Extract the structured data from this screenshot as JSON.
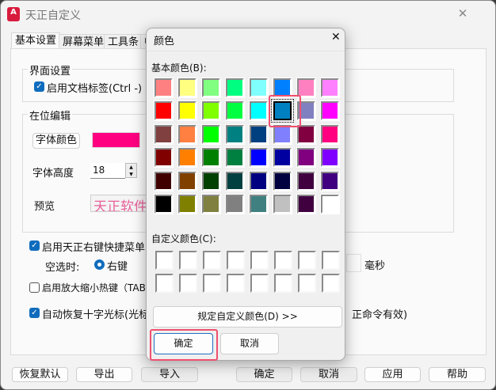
{
  "window": {
    "title": "天正自定义",
    "logo": "A",
    "close": "✕"
  },
  "tabs": [
    {
      "label": "基本设置"
    },
    {
      "label": "屏幕菜单"
    },
    {
      "label": "工具条"
    },
    {
      "label": "中"
    }
  ],
  "ui_group": {
    "title": "界面设置",
    "doc_tabs": {
      "label": "启用文档标签(Ctrl -)",
      "checked": true
    }
  },
  "inplace_group": {
    "title": "在位编辑",
    "font_color_button": "字体颜色",
    "font_color": "#ff0080",
    "font_height_label": "字体高度",
    "font_height": "18",
    "preview_label": "预览",
    "preview_text": "天正软件"
  },
  "right_menu": {
    "label": "启用天正右键快捷菜单",
    "checked": true,
    "empty_select_label": "空选时:",
    "radio_label": "右键",
    "ms_label": "毫秒"
  },
  "zoom_hotkey": {
    "label": "启用放大缩小热键（TAB/",
    "checked": false
  },
  "auto_cursor": {
    "label": "自动恢复十字光标(光标秒",
    "suffix": "正命令有效)",
    "checked": true
  },
  "footer": {
    "restore": "恢复默认",
    "export": "导出",
    "import": "导入",
    "ok": "确定",
    "cancel": "取消",
    "apply": "应用",
    "help": "帮助"
  },
  "color_dialog": {
    "title": "颜色",
    "close": "✕",
    "basic_label": "基本颜色(B):",
    "custom_label": "自定义颜色(C):",
    "define_button": "规定自定义颜色(D) >>",
    "ok": "确定",
    "cancel": "取消",
    "selected_index": 13,
    "basic_colors": [
      "#ff8080",
      "#ffff80",
      "#80ff80",
      "#00ff80",
      "#80ffff",
      "#0080ff",
      "#ff80c0",
      "#ff80ff",
      "#ff0000",
      "#ffff00",
      "#80ff00",
      "#00ff40",
      "#00ffff",
      "#0080c0",
      "#8080c0",
      "#ff00ff",
      "#804040",
      "#ff8040",
      "#00ff00",
      "#008080",
      "#004080",
      "#8080ff",
      "#800040",
      "#ff0080",
      "#800000",
      "#ff8000",
      "#008000",
      "#008040",
      "#0000ff",
      "#0000a0",
      "#800080",
      "#8000ff",
      "#400000",
      "#804000",
      "#004000",
      "#004040",
      "#000080",
      "#000040",
      "#400040",
      "#400080",
      "#000000",
      "#808000",
      "#808040",
      "#808080",
      "#408080",
      "#c0c0c0",
      "#400040",
      "#ffffff"
    ],
    "custom_colors": [
      "#ffffff",
      "#ffffff",
      "#ffffff",
      "#ffffff",
      "#ffffff",
      "#ffffff",
      "#ffffff",
      "#ffffff",
      "#ffffff",
      "#ffffff",
      "#ffffff",
      "#ffffff",
      "#ffffff",
      "#ffffff",
      "#ffffff",
      "#ffffff"
    ]
  }
}
